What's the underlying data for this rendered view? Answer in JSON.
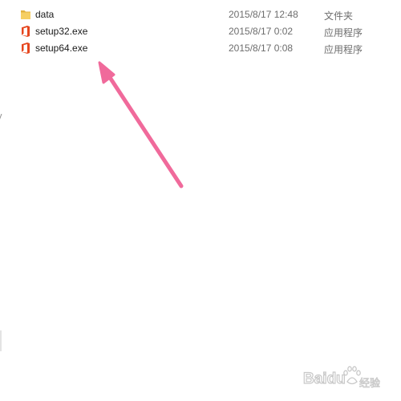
{
  "files": [
    {
      "name": "data",
      "modified": "2015/8/17 12:48",
      "type": "文件夹",
      "icon": "folder-icon"
    },
    {
      "name": "setup32.exe",
      "modified": "2015/8/17 0:02",
      "type": "应用程序",
      "icon": "office-setup-icon"
    },
    {
      "name": "setup64.exe",
      "modified": "2015/8/17 0:08",
      "type": "应用程序",
      "icon": "office-setup-icon"
    }
  ],
  "annotation": {
    "arrow_color": "#f06a9b"
  },
  "colors": {
    "office_orange": "#e6461e",
    "folder_yellow": "#f6cf63"
  },
  "watermark": {
    "brand": "Baidu",
    "suffix": "经验"
  }
}
